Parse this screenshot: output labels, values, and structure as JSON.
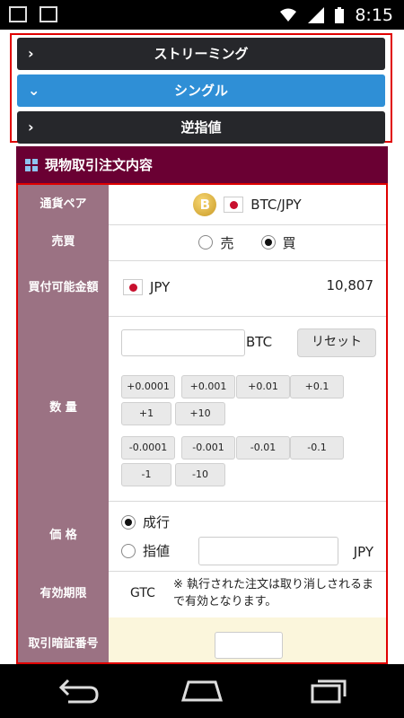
{
  "status_bar": {
    "time": "8:15"
  },
  "accordion": {
    "items": [
      {
        "label": "ストリーミング",
        "state": "collapsed"
      },
      {
        "label": "シングル",
        "state": "expanded"
      },
      {
        "label": "逆指値",
        "state": "collapsed"
      }
    ]
  },
  "section": {
    "title": "現物取引注文内容"
  },
  "form": {
    "pair": {
      "label": "通貨ペア",
      "value": "BTC/JPY"
    },
    "side": {
      "label": "売買",
      "options": [
        "売",
        "買"
      ],
      "selected": "買"
    },
    "available": {
      "label": "買付可能金額",
      "currency": "JPY",
      "amount": "10,807"
    },
    "quantity": {
      "label": "数 量",
      "unit": "BTC",
      "value": "",
      "reset_label": "リセット",
      "plus_buttons": [
        "+0.0001",
        "+0.001",
        "+0.01",
        "+0.1",
        "+1",
        "+10"
      ],
      "minus_buttons": [
        "-0.0001",
        "-0.001",
        "-0.01",
        "-0.1",
        "-1",
        "-10"
      ]
    },
    "price": {
      "label": "価 格",
      "options": [
        "成行",
        "指値"
      ],
      "selected": "成行",
      "value": "",
      "unit": "JPY"
    },
    "validity": {
      "label": "有効期限",
      "value": "GTC",
      "note": "※ 執行された注文は取り消しされるまで有効となります。"
    },
    "pin": {
      "label": "取引暗証番号",
      "value": ""
    }
  },
  "colors": {
    "header_bg": "#6a0033",
    "label_bg": "#9b7283",
    "active_tab": "#2f8fd6",
    "inactive_tab": "#26272b",
    "highlight_border": "#e00000"
  }
}
